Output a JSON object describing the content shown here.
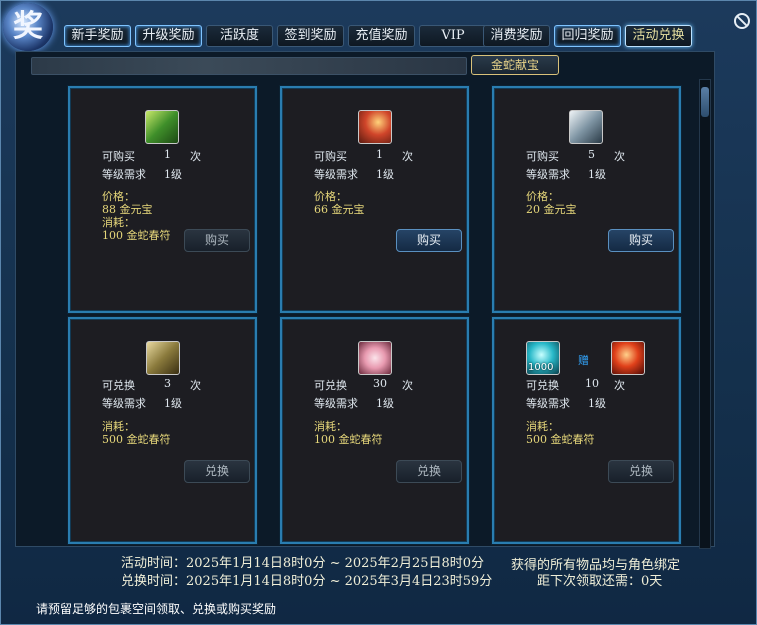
{
  "emblem": "奖",
  "tabs": [
    {
      "label": "新手奖励"
    },
    {
      "label": "升级奖励"
    },
    {
      "label": "活跃度"
    },
    {
      "label": "签到奖励"
    },
    {
      "label": "充值奖励"
    },
    {
      "label": "VIP"
    },
    {
      "label": "消费奖励"
    },
    {
      "label": "回归奖励"
    },
    {
      "label": "活动兑换"
    }
  ],
  "subtab": "金蛇献宝",
  "cards": [
    {
      "count_label": "可购买",
      "count": "1",
      "unit": "次",
      "level_label": "等级需求",
      "level": "1级",
      "price_label": "价格：",
      "price": "88 金元宝",
      "cost_label": "消耗：",
      "cost": "100 金蛇春符",
      "button": "购买",
      "icon": "treasure-chest-green-icon"
    },
    {
      "count_label": "可购买",
      "count": "1",
      "unit": "次",
      "level_label": "等级需求",
      "level": "1级",
      "price_label": "价格：",
      "price": "66 金元宝",
      "button": "购买",
      "icon": "fire-scepter-icon"
    },
    {
      "count_label": "可购买",
      "count": "5",
      "unit": "次",
      "level_label": "等级需求",
      "level": "1级",
      "price_label": "价格：",
      "price": "20 金元宝",
      "button": "购买",
      "icon": "silver-chest-icon"
    },
    {
      "count_label": "可兑换",
      "count": "3",
      "unit": "次",
      "level_label": "等级需求",
      "level": "1级",
      "cost_label": "消耗：",
      "cost": "500 金蛇春符",
      "button": "兑换",
      "icon": "scroll-icon"
    },
    {
      "count_label": "可兑换",
      "count": "30",
      "unit": "次",
      "level_label": "等级需求",
      "level": "1级",
      "cost_label": "消耗：",
      "cost": "100 金蛇春符",
      "button": "兑换",
      "icon": "pink-petal-icon"
    },
    {
      "count_label": "可兑换",
      "count": "10",
      "unit": "次",
      "level_label": "等级需求",
      "level": "1级",
      "cost_label": "消耗：",
      "cost": "500 金蛇春符",
      "button": "兑换",
      "icon": "cyan-orb-icon",
      "gift_label": "赠",
      "icon_badge": "1000",
      "gift_icon": "red-orb-icon"
    }
  ],
  "footer": {
    "activity_time": "活动时间：2025年1月14日8时0分 ~ 2025年2月25日8时0分",
    "exchange_time": "兑换时间：2025年1月14日8时0分 ~ 2025年3月4日23时59分",
    "binding_note": "获得的所有物品均与角色绑定",
    "next_claim": "距下次领取还需：0天"
  },
  "notice": "请预留足够的包裹空间领取、兑换或购买奖励",
  "colors": {
    "accent": "#2a7db0",
    "gold": "#e6d77a",
    "gift": "#33a7ff"
  }
}
